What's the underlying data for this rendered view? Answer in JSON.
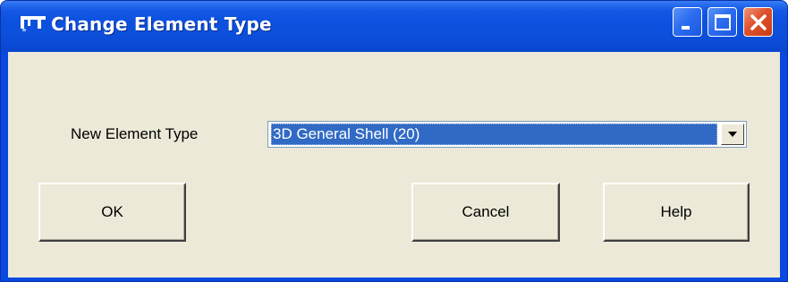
{
  "window": {
    "title": "Change Element Type",
    "icon": "app-logo-icon",
    "controls": {
      "minimize": "minimize-icon",
      "maximize": "maximize-icon",
      "close": "close-icon"
    },
    "colors": {
      "title_bar": "#0c50dc",
      "client": "#ece9d8",
      "selection": "#316ac5",
      "close_button": "#e0512b"
    }
  },
  "form": {
    "element_type_label": "New Element Type",
    "element_type_value": "3D General Shell (20)",
    "dropdown_icon": "chevron-down-icon"
  },
  "buttons": {
    "ok": "OK",
    "cancel": "Cancel",
    "help": "Help"
  }
}
